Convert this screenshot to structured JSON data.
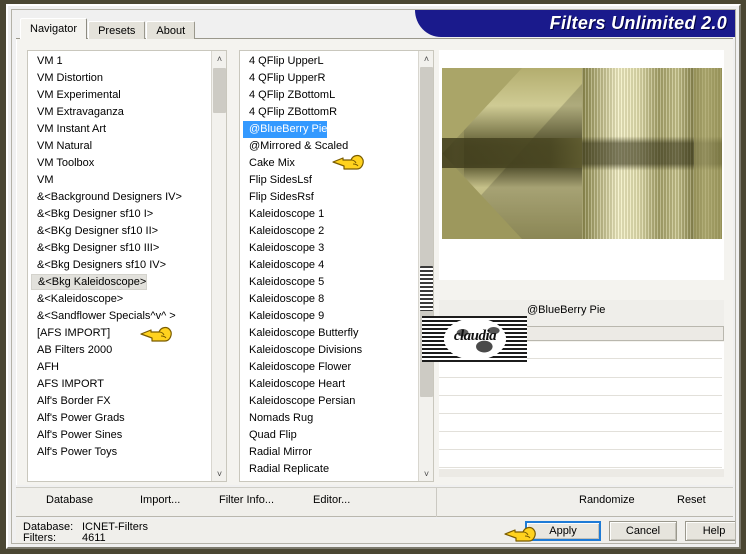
{
  "window": {
    "banner_title": "Filters Unlimited 2.0",
    "banner_color": "#1a1a8c",
    "frame_color": "#4a4632"
  },
  "tabs": [
    {
      "label": "Navigator",
      "active": true
    },
    {
      "label": "Presets",
      "active": false
    },
    {
      "label": "About",
      "active": false
    }
  ],
  "category_list": {
    "name": "filter-category-list",
    "selected": "&<Bkg Kaleidoscope>",
    "items": [
      "VM 1",
      "VM Distortion",
      "VM Experimental",
      "VM Extravaganza",
      "VM Instant Art",
      "VM Natural",
      "VM Toolbox",
      "VM",
      "&<Background Designers IV>",
      "&<Bkg Designer sf10 I>",
      "&<BKg Designer sf10 II>",
      "&<Bkg Designer sf10 III>",
      "&<Bkg Designers sf10 IV>",
      "&<Bkg Kaleidoscope>",
      "&<Kaleidoscope>",
      "&<Sandflower Specials^v^ >",
      "[AFS IMPORT]",
      "AB Filters 2000",
      "AFH",
      "AFS IMPORT",
      "Alf's Border FX",
      "Alf's Power Grads",
      "Alf's Power Sines",
      "Alf's Power Toys"
    ]
  },
  "filter_list": {
    "name": "filter-effect-list",
    "selected": "@BlueBerry Pie",
    "items": [
      "4 QFlip UpperL",
      "4 QFlip UpperR",
      "4 QFlip ZBottomL",
      "4 QFlip ZBottomR",
      "@BlueBerry Pie",
      "@Mirrored & Scaled",
      "Cake Mix",
      "Flip SidesLsf",
      "Flip SidesRsf",
      "Kaleidoscope 1",
      "Kaleidoscope 2",
      "Kaleidoscope 3",
      "Kaleidoscope 4",
      "Kaleidoscope 5",
      "Kaleidoscope 8",
      "Kaleidoscope 9",
      "Kaleidoscope Butterfly",
      "Kaleidoscope Divisions",
      "Kaleidoscope Flower",
      "Kaleidoscope Heart",
      "Kaleidoscope Persian",
      "Nomads Rug",
      "Quad Flip",
      "Radial Mirror",
      "Radial Replicate"
    ]
  },
  "preview": {
    "current_filter_label": "@BlueBerry Pie",
    "watermark": "claudia"
  },
  "toolbar": {
    "database_label": "Database",
    "import_label": "Import...",
    "filter_info_label": "Filter Info...",
    "editor_label": "Editor...",
    "randomize_label": "Randomize",
    "reset_label": "Reset"
  },
  "status": {
    "database_key": "Database:",
    "database_value": "ICNET-Filters",
    "filters_key": "Filters:",
    "filters_value": "4611"
  },
  "buttons": {
    "apply_label": "Apply",
    "cancel_label": "Cancel",
    "help_label": "Help"
  },
  "icons": {
    "scroll_up": "˄",
    "scroll_down": "˅"
  }
}
